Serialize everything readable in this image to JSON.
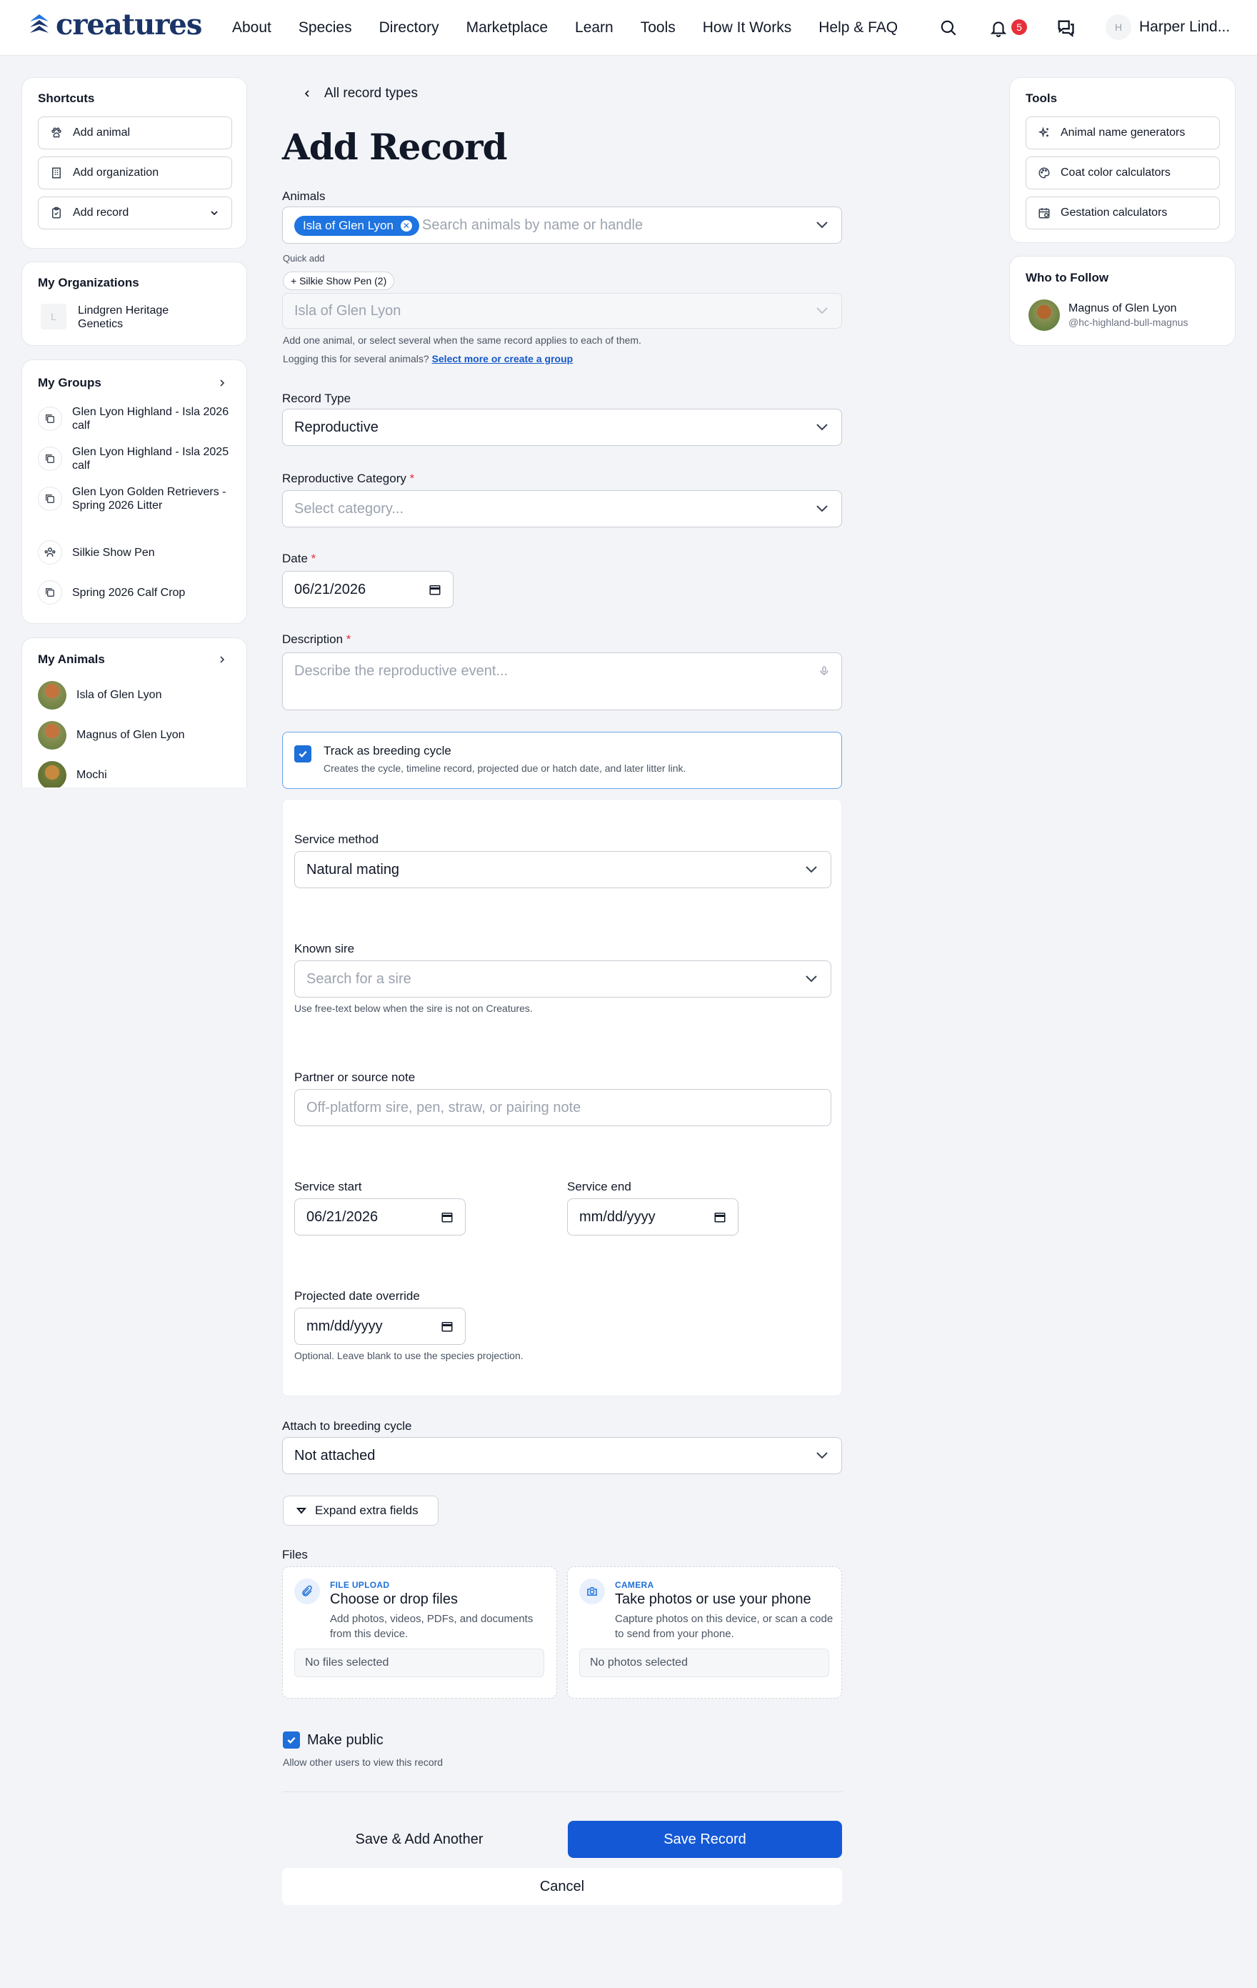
{
  "header": {
    "logo_text": "creatures",
    "nav": [
      "About",
      "Species",
      "Directory",
      "Marketplace",
      "Learn",
      "Tools",
      "How It Works",
      "Help & FAQ"
    ],
    "notification_count": "5",
    "user_initial": "H",
    "user_name": "Harper Lind..."
  },
  "shortcuts": {
    "title": "Shortcuts",
    "items": [
      "Add animal",
      "Add organization",
      "Add record"
    ]
  },
  "organizations": {
    "title": "My Organizations",
    "initial": "L",
    "items": [
      "Lindgren Heritage Genetics"
    ]
  },
  "groups": {
    "title": "My Groups",
    "items": [
      "Glen Lyon Highland - Isla 2026 calf",
      "Glen Lyon Highland - Isla 2025 calf",
      "Glen Lyon Golden Retrievers - Spring 2026 Litter",
      "Silkie Show Pen",
      "Spring 2026 Calf Crop"
    ]
  },
  "animals": {
    "title": "My Animals",
    "items": [
      "Isla of Glen Lyon",
      "Magnus of Glen Lyon",
      "Mochi"
    ]
  },
  "tools": {
    "title": "Tools",
    "items": [
      "Animal name generators",
      "Coat color calculators",
      "Gestation calculators"
    ]
  },
  "follow": {
    "title": "Who to Follow",
    "name": "Magnus of Glen Lyon",
    "handle": "@hc-highland-bull-magnus"
  },
  "form": {
    "back_label": "All record types",
    "title": "Add Record",
    "animals_label": "Animals",
    "selected_animal": "Isla of Glen Lyon",
    "animals_placeholder": "Search animals by name or handle",
    "quick_add_label": "Quick add",
    "quick_add_pill": "+ Silkie Show Pen (2)",
    "secondary_select": "Isla of Glen Lyon",
    "help_one": "Add one animal, or select several when the same record applies to each of them.",
    "help_two_prefix": "Logging this for several animals?",
    "help_two_link": "Select more or create a group",
    "record_type_label": "Record Type",
    "record_type_value": "Reproductive",
    "category_label": "Reproductive Category",
    "category_placeholder": "Select category...",
    "date_label": "Date",
    "date_value": "06/21/2026",
    "description_label": "Description",
    "description_placeholder": "Describe the reproductive event...",
    "breeding_title": "Track as breeding cycle",
    "breeding_desc": "Creates the cycle, timeline record, projected due or hatch date, and later litter link.",
    "service_method_label": "Service method",
    "service_method_value": "Natural mating",
    "known_sire_label": "Known sire",
    "known_sire_placeholder": "Search for a sire",
    "known_sire_help": "Use free-text below when the sire is not on Creatures.",
    "partner_label": "Partner or source note",
    "partner_placeholder": "Off-platform sire, pen, straw, or pairing note",
    "service_start_label": "Service start",
    "service_start_value": "06/21/2026",
    "service_end_label": "Service end",
    "service_end_value": "mm/dd/yyyy",
    "projected_label": "Projected date override",
    "projected_value": "mm/dd/yyyy",
    "projected_help": "Optional. Leave blank to use the species projection.",
    "attach_label": "Attach to breeding cycle",
    "attach_value": "Not attached",
    "expand_label": "Expand extra fields",
    "files_label": "Files",
    "upload_kicker": "FILE UPLOAD",
    "upload_title": "Choose or drop files",
    "upload_desc": "Add photos, videos, PDFs, and documents from this device.",
    "upload_status": "No files selected",
    "camera_kicker": "CAMERA",
    "camera_title": "Take photos or use your phone",
    "camera_desc": "Capture photos on this device, or scan a code to send from your phone.",
    "camera_status": "No photos selected",
    "public_label": "Make public",
    "public_help": "Allow other users to view this record",
    "save_add_label": "Save & Add Another",
    "save_label": "Save Record",
    "cancel_label": "Cancel"
  },
  "colors": {
    "brand": "#1a3468",
    "primary": "#1458d6",
    "chip": "#1e74e0",
    "badge": "#e5303a"
  }
}
